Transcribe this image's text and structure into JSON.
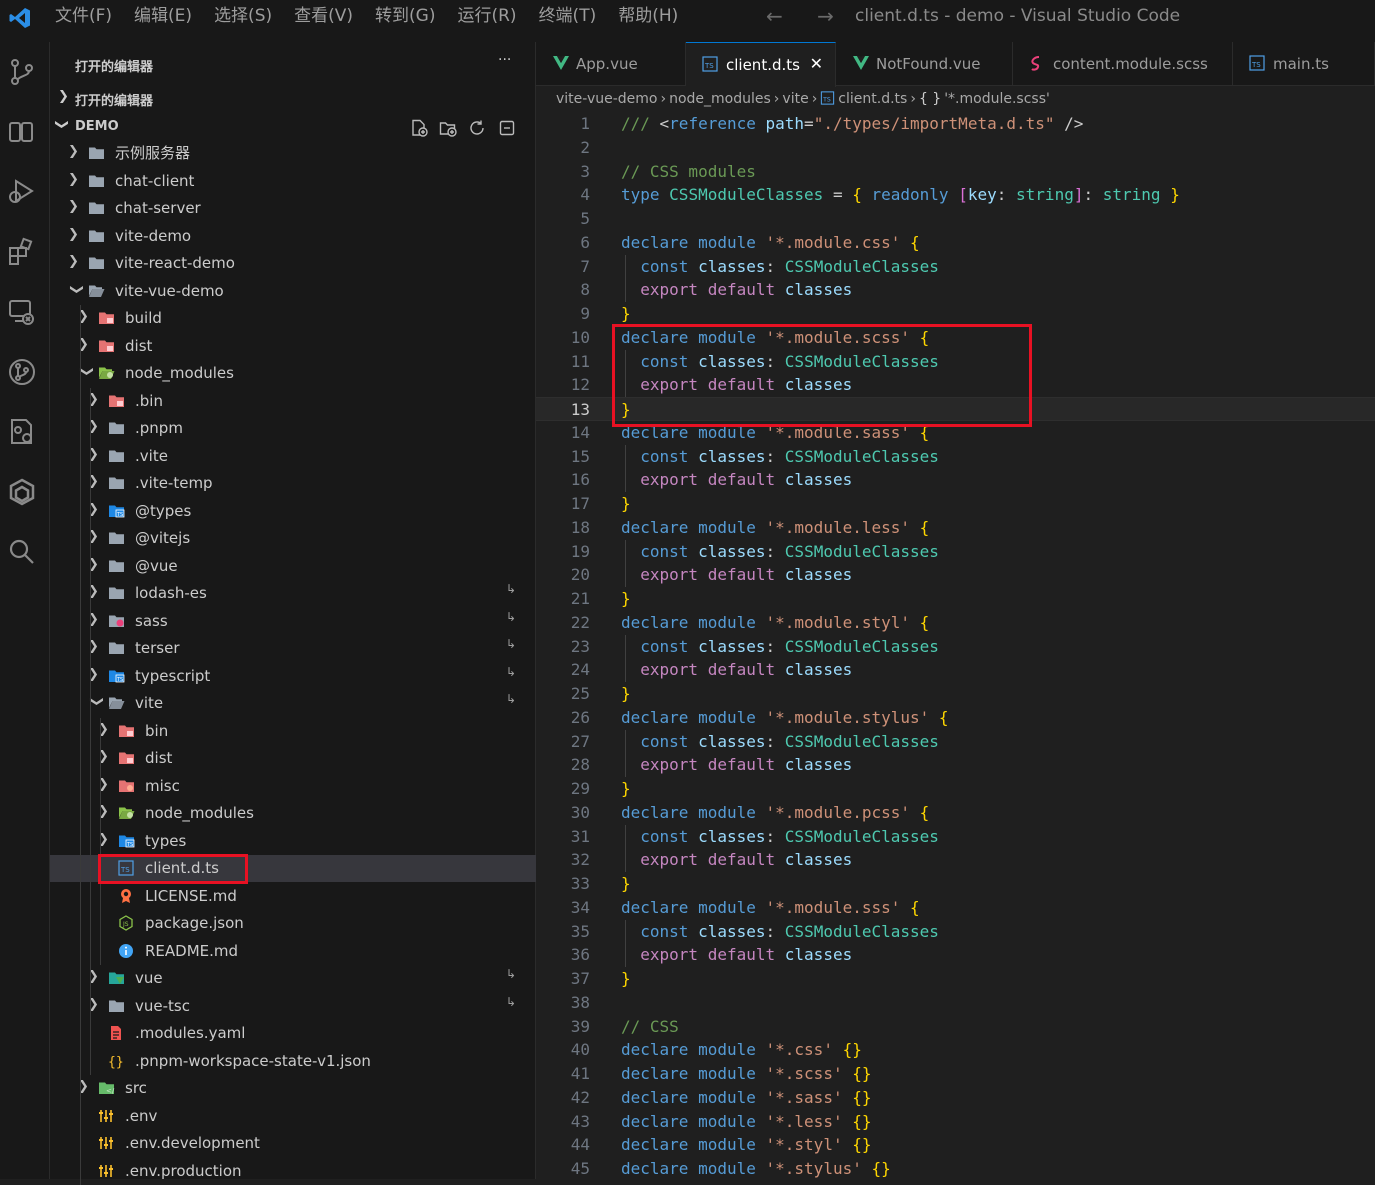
{
  "titlebar": {
    "menus": [
      "文件(F)",
      "编辑(E)",
      "选择(S)",
      "查看(V)",
      "转到(G)",
      "运行(R)",
      "终端(T)",
      "帮助(H)"
    ],
    "nav_arrows": "← →",
    "window_title": "client.d.ts - demo - Visual Studio Code"
  },
  "activity_bar": [
    "source-control",
    "explorer",
    "run-debug",
    "extensions",
    "remote-explorer",
    "git-graph",
    "testing",
    "package",
    "search"
  ],
  "sidebar": {
    "open_editors_title": "打开的编辑器",
    "more_label": "···",
    "open_editors_section": "打开的编辑器",
    "demo_section": "DEMO",
    "tree": [
      {
        "label": "示例服务器",
        "depth": 0,
        "open": false,
        "icon": "folder"
      },
      {
        "label": "chat-client",
        "depth": 0,
        "open": false,
        "icon": "folder"
      },
      {
        "label": "chat-server",
        "depth": 0,
        "open": false,
        "icon": "folder"
      },
      {
        "label": "vite-demo",
        "depth": 0,
        "open": false,
        "icon": "folder"
      },
      {
        "label": "vite-react-demo",
        "depth": 0,
        "open": false,
        "icon": "folder"
      },
      {
        "label": "vite-vue-demo",
        "depth": 0,
        "open": true,
        "icon": "folder-open"
      },
      {
        "label": "build",
        "depth": 1,
        "open": false,
        "icon": "folder-red"
      },
      {
        "label": "dist",
        "depth": 1,
        "open": false,
        "icon": "folder-red"
      },
      {
        "label": "node_modules",
        "depth": 1,
        "open": true,
        "icon": "folder-green"
      },
      {
        "label": ".bin",
        "depth": 2,
        "open": false,
        "icon": "folder-red"
      },
      {
        "label": ".pnpm",
        "depth": 2,
        "open": false,
        "icon": "folder"
      },
      {
        "label": ".vite",
        "depth": 2,
        "open": false,
        "icon": "folder"
      },
      {
        "label": ".vite-temp",
        "depth": 2,
        "open": false,
        "icon": "folder"
      },
      {
        "label": "@types",
        "depth": 2,
        "open": false,
        "icon": "folder-ts"
      },
      {
        "label": "@vitejs",
        "depth": 2,
        "open": false,
        "icon": "folder"
      },
      {
        "label": "@vue",
        "depth": 2,
        "open": false,
        "icon": "folder"
      },
      {
        "label": "lodash-es",
        "depth": 2,
        "open": false,
        "icon": "folder",
        "symlink": true
      },
      {
        "label": "sass",
        "depth": 2,
        "open": false,
        "icon": "folder-sass",
        "symlink": true
      },
      {
        "label": "terser",
        "depth": 2,
        "open": false,
        "icon": "folder",
        "symlink": true
      },
      {
        "label": "typescript",
        "depth": 2,
        "open": false,
        "icon": "folder-ts",
        "symlink": true
      },
      {
        "label": "vite",
        "depth": 2,
        "open": true,
        "icon": "folder-open",
        "symlink": true
      },
      {
        "label": "bin",
        "depth": 3,
        "open": false,
        "icon": "folder-red"
      },
      {
        "label": "dist",
        "depth": 3,
        "open": false,
        "icon": "folder-red"
      },
      {
        "label": "misc",
        "depth": 3,
        "open": false,
        "icon": "folder-orange"
      },
      {
        "label": "node_modules",
        "depth": 3,
        "open": false,
        "icon": "folder-green"
      },
      {
        "label": "types",
        "depth": 3,
        "open": false,
        "icon": "folder-ts"
      },
      {
        "label": "client.d.ts",
        "depth": 3,
        "file": true,
        "icon": "file-ts",
        "selected": true
      },
      {
        "label": "LICENSE.md",
        "depth": 3,
        "file": true,
        "icon": "file-license"
      },
      {
        "label": "package.json",
        "depth": 3,
        "file": true,
        "icon": "file-node"
      },
      {
        "label": "README.md",
        "depth": 3,
        "file": true,
        "icon": "file-info"
      },
      {
        "label": "vue",
        "depth": 2,
        "open": false,
        "icon": "folder-vue",
        "symlink": true
      },
      {
        "label": "vue-tsc",
        "depth": 2,
        "open": false,
        "icon": "folder",
        "symlink": true
      },
      {
        "label": ".modules.yaml",
        "depth": 2,
        "file": true,
        "icon": "file-yaml"
      },
      {
        "label": ".pnpm-workspace-state-v1.json",
        "depth": 2,
        "file": true,
        "icon": "file-json"
      },
      {
        "label": "src",
        "depth": 1,
        "open": false,
        "icon": "folder-src"
      },
      {
        "label": ".env",
        "depth": 1,
        "file": true,
        "icon": "file-env"
      },
      {
        "label": ".env.development",
        "depth": 1,
        "file": true,
        "icon": "file-env"
      },
      {
        "label": ".env.production",
        "depth": 1,
        "file": true,
        "icon": "file-env"
      }
    ]
  },
  "tabs": [
    {
      "label": "App.vue",
      "icon": "vue",
      "active": false
    },
    {
      "label": "client.d.ts",
      "icon": "ts",
      "active": true,
      "close": "✕"
    },
    {
      "label": "NotFound.vue",
      "icon": "vue",
      "active": false
    },
    {
      "label": "content.module.scss",
      "icon": "sass",
      "active": false
    },
    {
      "label": "main.ts",
      "icon": "ts",
      "active": false
    }
  ],
  "breadcrumbs": [
    "vite-vue-demo",
    "node_modules",
    "vite",
    "client.d.ts",
    "'*.module.scss'"
  ],
  "breadcrumb_sep": "›",
  "symbol_icon": "{ }",
  "current_line": 13,
  "code_lines": [
    "/// <reference path=\"./types/importMeta.d.ts\" />",
    "",
    "// CSS modules",
    "type CSSModuleClasses = { readonly [key: string]: string }",
    "",
    "declare module '*.module.css' {",
    "  const classes: CSSModuleClasses",
    "  export default classes",
    "}",
    "declare module '*.module.scss' {",
    "  const classes: CSSModuleClasses",
    "  export default classes",
    "}",
    "declare module '*.module.sass' {",
    "  const classes: CSSModuleClasses",
    "  export default classes",
    "}",
    "declare module '*.module.less' {",
    "  const classes: CSSModuleClasses",
    "  export default classes",
    "}",
    "declare module '*.module.styl' {",
    "  const classes: CSSModuleClasses",
    "  export default classes",
    "}",
    "declare module '*.module.stylus' {",
    "  const classes: CSSModuleClasses",
    "  export default classes",
    "}",
    "declare module '*.module.pcss' {",
    "  const classes: CSSModuleClasses",
    "  export default classes",
    "}",
    "declare module '*.module.sss' {",
    "  const classes: CSSModuleClasses",
    "  export default classes",
    "}",
    "",
    "// CSS",
    "declare module '*.css' {}",
    "declare module '*.scss' {}",
    "declare module '*.sass' {}",
    "declare module '*.less' {}",
    "declare module '*.styl' {}",
    "declare module '*.stylus' {}"
  ],
  "colors": {
    "accent": "#0078d4",
    "highlight_box": "#e81123",
    "keyword": "#569cd6",
    "control_keyword": "#c586c0",
    "string": "#ce9178",
    "type": "#4ec9b0",
    "variable": "#9cdcfe",
    "comment": "#6a9955"
  }
}
